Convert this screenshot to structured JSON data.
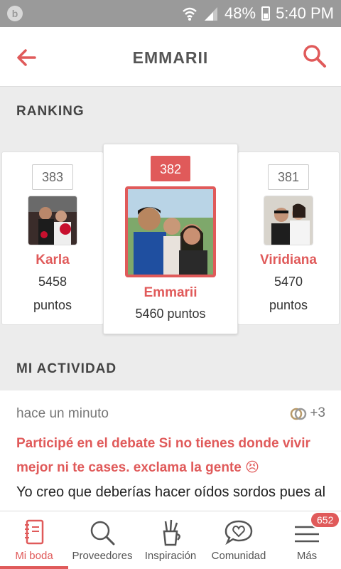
{
  "statusbar": {
    "battery": "48%",
    "time": "5:40 PM",
    "left_icon": "b-icon"
  },
  "header": {
    "title": "EMMARII"
  },
  "ranking": {
    "title": "RANKING",
    "left": {
      "rank": "383",
      "name": "Karla",
      "points": "5458",
      "unit": "puntos"
    },
    "center": {
      "rank": "382",
      "name": "Emmarii",
      "points_text": "5460 puntos"
    },
    "right": {
      "rank": "381",
      "name": "Viridiana",
      "points": "5470",
      "unit": "puntos"
    }
  },
  "activity": {
    "title": "MI ACTIVIDAD",
    "time": "hace un minuto",
    "likes": "+3",
    "headline": "Participé en el debate Si no tienes donde vivir mejor ni te cases. exclama la gente 😣",
    "body": "Yo creo que deberías hacer oídos sordos pues al"
  },
  "nav": {
    "items": [
      {
        "label": "Mi boda",
        "icon": "notebook-icon"
      },
      {
        "label": "Proveedores",
        "icon": "search-icon"
      },
      {
        "label": "Inspiración",
        "icon": "brushes-icon"
      },
      {
        "label": "Comunidad",
        "icon": "heart-chat-icon"
      },
      {
        "label": "Más",
        "icon": "menu-icon"
      }
    ],
    "badge": "652"
  },
  "colors": {
    "accent": "#e05a5a",
    "status_bar": "#9a9a9a",
    "background": "#ececec"
  }
}
